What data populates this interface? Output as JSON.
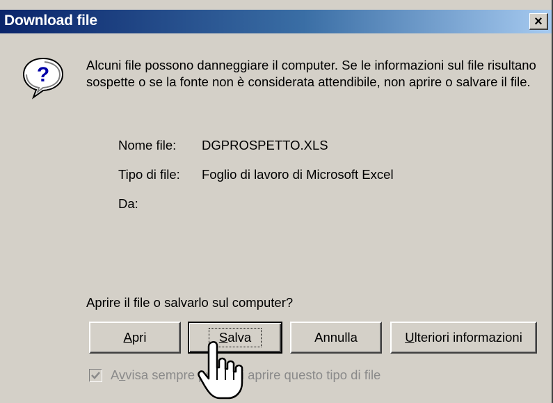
{
  "dialog": {
    "title": "Download file",
    "close_glyph": "×",
    "icon": "question-icon",
    "message": "Alcuni file possono danneggiare il computer. Se le informazioni sul file risultano sospette o se la fonte non è considerata attendibile, non aprire o salvare il file.",
    "file_info": {
      "name_label": "Nome file:",
      "name_value": "DGPROSPETTO.XLS",
      "type_label": "Tipo di file:",
      "type_value": "Foglio di lavoro di Microsoft Excel",
      "from_label": "Da:",
      "from_value": ""
    },
    "prompt": "Aprire il file o salvarlo sul computer?",
    "buttons": {
      "apri_hotkey": "A",
      "apri_rest": "pri",
      "salva_hotkey": "S",
      "salva_rest": "alva",
      "annulla": "Annulla",
      "ulteriori_hotkey": "U",
      "ulteriori_rest": "lteriori informazioni"
    },
    "checkbox": {
      "checked": true,
      "label_before": "A",
      "label_hotkey": "v",
      "label_after": "visa sempre prima di aprire questo tipo di file"
    },
    "cursor": "hand-pointer-icon"
  },
  "colors": {
    "face": "#d4d0c8",
    "title_start": "#0a246a",
    "title_end": "#a6caf0",
    "disabled_text": "#8a8a8a"
  }
}
